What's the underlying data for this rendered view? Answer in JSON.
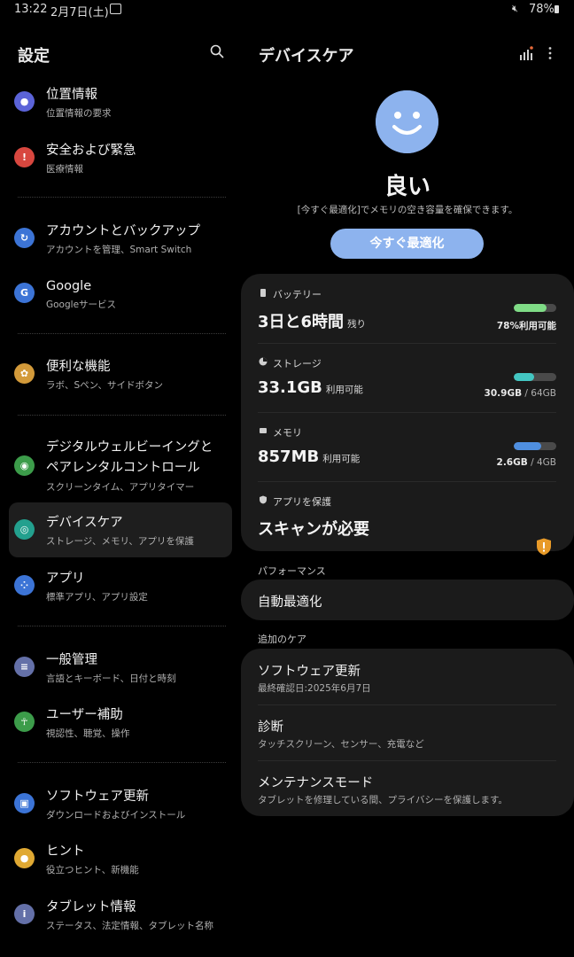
{
  "status_bar": {
    "time": "13:22",
    "date": "2月7日(土)",
    "battery": "78%"
  },
  "left": {
    "title": "設定",
    "items": [
      {
        "title": "位置情報",
        "sub": "位置情報の要求",
        "icon": "location-icon",
        "color": "#5b63d8"
      },
      {
        "title": "安全および緊急",
        "sub": "医療情報",
        "icon": "emergency-icon",
        "color": "#d8473f"
      },
      {
        "title": "アカウントとバックアップ",
        "sub": "アカウントを管理、Smart Switch",
        "icon": "sync-icon",
        "color": "#3c74d6"
      },
      {
        "title": "Google",
        "sub": "Googleサービス",
        "icon": "google-icon",
        "color": "#3c74d6"
      },
      {
        "title": "便利な機能",
        "sub": "ラボ、Sペン、サイドボタン",
        "icon": "advanced-features-icon",
        "color": "#d39a3a"
      },
      {
        "title": "デジタルウェルビーイングと",
        "title2": "ペアレンタルコントロール",
        "sub": "スクリーンタイム、アプリタイマー",
        "icon": "wellbeing-icon",
        "color": "#3c9c4a"
      },
      {
        "title": "デバイスケア",
        "sub": "ストレージ、メモリ、アプリを保護",
        "icon": "device-care-icon",
        "color": "#23a08e"
      },
      {
        "title": "アプリ",
        "sub": "標準アプリ、アプリ設定",
        "icon": "apps-icon",
        "color": "#3c74d6"
      },
      {
        "title": "一般管理",
        "sub": "言語とキーボード、日付と時刻",
        "icon": "general-management-icon",
        "color": "#6470a8"
      },
      {
        "title": "ユーザー補助",
        "sub": "視認性、聴覚、操作",
        "icon": "accessibility-icon",
        "color": "#3c9c4a"
      },
      {
        "title": "ソフトウェア更新",
        "sub": "ダウンロードおよびインストール",
        "icon": "software-update-icon",
        "color": "#3c74d6"
      },
      {
        "title": "ヒント",
        "sub": "役立つヒント、新機能",
        "icon": "tips-icon",
        "color": "#e0a933"
      },
      {
        "title": "タブレット情報",
        "sub": "ステータス、法定情報、タブレット名称",
        "icon": "info-icon",
        "color": "#6470a8"
      }
    ]
  },
  "right": {
    "title": "デバイスケア",
    "status": "良い",
    "desc": "[今すぐ最適化]でメモリの空き容量を確保できます。",
    "optimize_button": "今すぐ最適化",
    "battery": {
      "label": "バッテリー",
      "value": "3日と6時間",
      "unit": "残り",
      "bar_text": "78%利用可能",
      "fill": 0.78,
      "color": "#7fdc86"
    },
    "storage": {
      "label": "ストレージ",
      "value": "33.1GB",
      "unit": "利用可能",
      "used": "30.9GB",
      "total": "64GB",
      "fill": 0.48,
      "color": "#43c6c2"
    },
    "memory": {
      "label": "メモリ",
      "value": "857MB",
      "unit": "利用可能",
      "used": "2.6GB",
      "total": "4GB",
      "fill": 0.65,
      "color": "#4f8fe0"
    },
    "protection": {
      "label": "アプリを保護",
      "value": "スキャンが必要"
    },
    "performance_header": "パフォーマンス",
    "auto_optimize": "自動最適化",
    "additional_header": "追加のケア",
    "additional": [
      {
        "title": "ソフトウェア更新",
        "sub": "最終確認日:2025年6月7日"
      },
      {
        "title": "診断",
        "sub": "タッチスクリーン、センサー、充電など"
      },
      {
        "title": "メンテナンスモード",
        "sub": "タブレットを修理している間、プライバシーを保護します。"
      }
    ]
  }
}
